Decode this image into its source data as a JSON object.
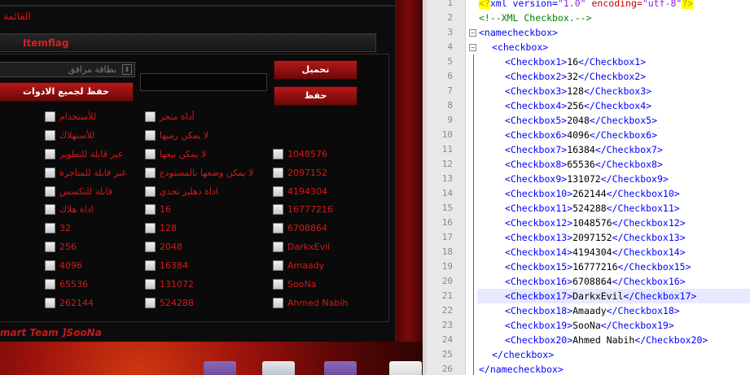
{
  "app": {
    "title": "القائمة",
    "tab_label": "Itemflag",
    "category_value": "بطاقة مرافق",
    "save_all_label": "حفظ لجميع الادوات",
    "load_label": "تحميل",
    "save_label": "حفظ",
    "status_text": "mart Team ]SooNa",
    "checkboxes": [
      {
        "label": "للأستخدام"
      },
      {
        "label": "للأستهلاك"
      },
      {
        "label": "غير قابلة للتطوير"
      },
      {
        "label": "غير قابلة للمتاجرة"
      },
      {
        "label": "قابلة للتكسس"
      },
      {
        "label": "اداة هلاك"
      },
      {
        "label": "32"
      },
      {
        "label": "256"
      },
      {
        "label": "4096"
      },
      {
        "label": "65536"
      },
      {
        "label": "262144"
      },
      {
        "label": "أداة متجر"
      },
      {
        "label": "لا يمكن رميها"
      },
      {
        "label": "لا يمكن بيعها"
      },
      {
        "label": "لا يمكن وضعها بالمستودع"
      },
      {
        "label": "اداة دهليز تحدي"
      },
      {
        "label": "16"
      },
      {
        "label": "128"
      },
      {
        "label": "2048"
      },
      {
        "label": "16384"
      },
      {
        "label": "131072"
      },
      {
        "label": "524288"
      },
      {
        "label": "1048576"
      },
      {
        "label": "2097152"
      },
      {
        "label": "4194304"
      },
      {
        "label": "16777216"
      },
      {
        "label": "6708864"
      },
      {
        "label": "DarkxEvil"
      },
      {
        "label": "Amaady"
      },
      {
        "label": "SooNa"
      },
      {
        "label": "Ahmed Nabih"
      }
    ]
  },
  "editor": {
    "line_numbers": [
      "1",
      "2",
      "3",
      "4",
      "5",
      "6",
      "7",
      "8",
      "9",
      "10",
      "11",
      "12",
      "13",
      "14",
      "15",
      "16",
      "17",
      "18",
      "19",
      "20",
      "21",
      "22",
      "23",
      "24",
      "25",
      "26"
    ],
    "xml_decl": {
      "open": "<?",
      "body": "xml version=",
      "ver": "\"1.0\"",
      "enc_attr": " encoding=",
      "enc": "\"utf-8\"",
      "close": "?>"
    },
    "comment": "<!--XML Checkbox.-->",
    "root_open": "<namecheckbox>",
    "group_open": "<checkbox>",
    "entries": [
      {
        "tag": "Checkbox1",
        "value": "16"
      },
      {
        "tag": "Checkbox2",
        "value": "32"
      },
      {
        "tag": "Checkbox3",
        "value": "128"
      },
      {
        "tag": "Checkbox4",
        "value": "256"
      },
      {
        "tag": "Checkbox5",
        "value": "2048"
      },
      {
        "tag": "Checkbox6",
        "value": "4096"
      },
      {
        "tag": "Checkbox7",
        "value": "16384"
      },
      {
        "tag": "Checkbox8",
        "value": "65536"
      },
      {
        "tag": "Checkbox9",
        "value": "131072"
      },
      {
        "tag": "Checkbox10",
        "value": "262144"
      },
      {
        "tag": "Checkbox11",
        "value": "524288"
      },
      {
        "tag": "Checkbox12",
        "value": "1048576"
      },
      {
        "tag": "Checkbox13",
        "value": "2097152"
      },
      {
        "tag": "Checkbox14",
        "value": "4194304"
      },
      {
        "tag": "Checkbox15",
        "value": "16777216"
      },
      {
        "tag": "Checkbox16",
        "value": "6708864"
      },
      {
        "tag": "Checkbox17",
        "value": "DarkxEvil"
      },
      {
        "tag": "Checkbox18",
        "value": "Amaady"
      },
      {
        "tag": "Checkbox19",
        "value": "SooNa"
      },
      {
        "tag": "Checkbox20",
        "value": "Ahmed Nabih"
      }
    ],
    "group_close": "</checkbox>",
    "root_close": "</namecheckbox>",
    "highlighted_line": 21
  }
}
